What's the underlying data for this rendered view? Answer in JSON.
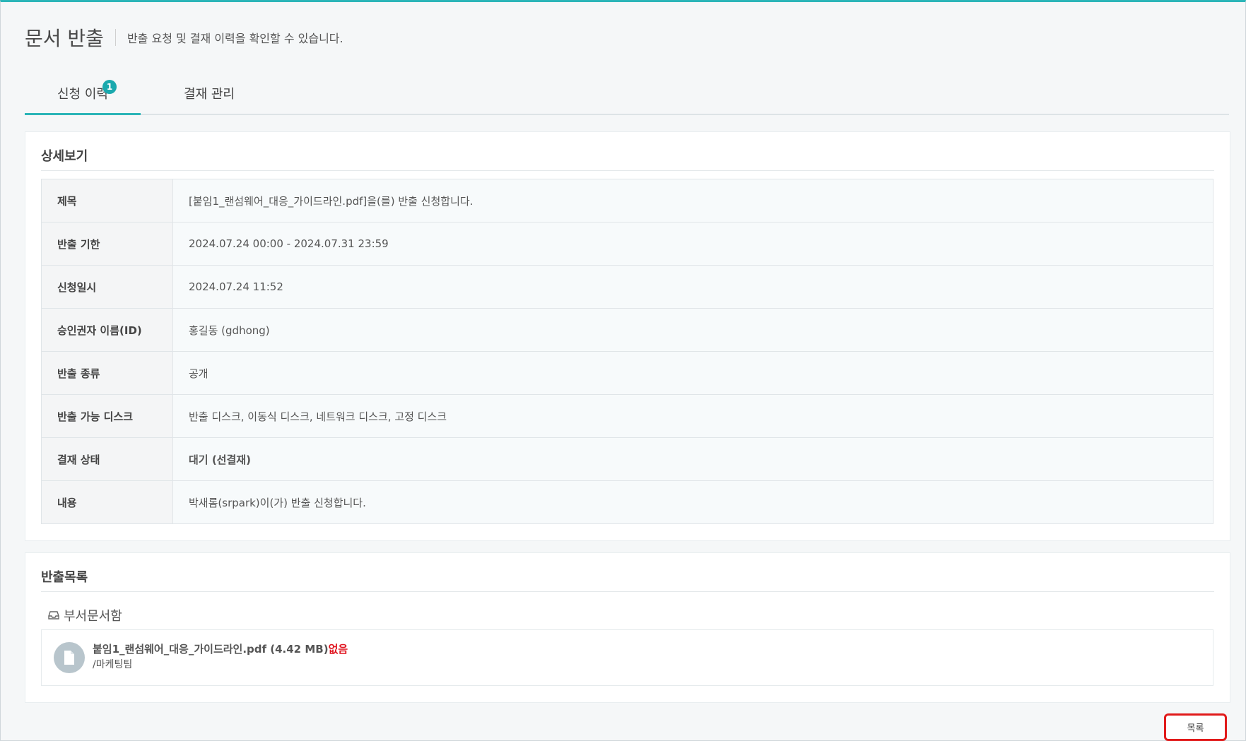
{
  "header": {
    "title": "문서 반출",
    "description": "반출 요청 및 결재 이력을 확인할 수 있습니다."
  },
  "tabs": [
    {
      "label": "신청 이력",
      "badge": "1",
      "active": true
    },
    {
      "label": "결재 관리",
      "active": false
    }
  ],
  "detail": {
    "title": "상세보기",
    "rows": [
      {
        "label": "제목",
        "value": "[붙임1_랜섬웨어_대응_가이드라인.pdf]을(를) 반출 신청합니다."
      },
      {
        "label": "반출 기한",
        "value": "2024.07.24 00:00 - 2024.07.31 23:59"
      },
      {
        "label": "신청일시",
        "value": "2024.07.24 11:52"
      },
      {
        "label": "승인권자 이름(ID)",
        "value": "홍길동 (gdhong)"
      },
      {
        "label": "반출 종류",
        "value": "공개"
      },
      {
        "label": "반출 가능 디스크",
        "value": "반출 디스크, 이동식 디스크, 네트워크 디스크, 고정 디스크"
      },
      {
        "label": "결재 상태",
        "value": "대기 (선결재)"
      },
      {
        "label": "내용",
        "value": "박새롬(srpark)이(가) 반출 신청합니다."
      }
    ]
  },
  "export_list": {
    "title": "반출목록",
    "folder": "부서문서함",
    "file": {
      "name": "붙임1_랜섬웨어_대응_가이드라인.pdf (4.42 MB)",
      "status": "없음",
      "path": "/마케팅팀"
    }
  },
  "footer": {
    "list_button": "목록"
  },
  "colors": {
    "accent": "#2bb5b8",
    "status": "#17aab2",
    "missing": "#e0141f",
    "highlight_border": "#e11a1a"
  },
  "icons": {
    "folder": "inbox-tray-icon",
    "file": "document-icon"
  }
}
